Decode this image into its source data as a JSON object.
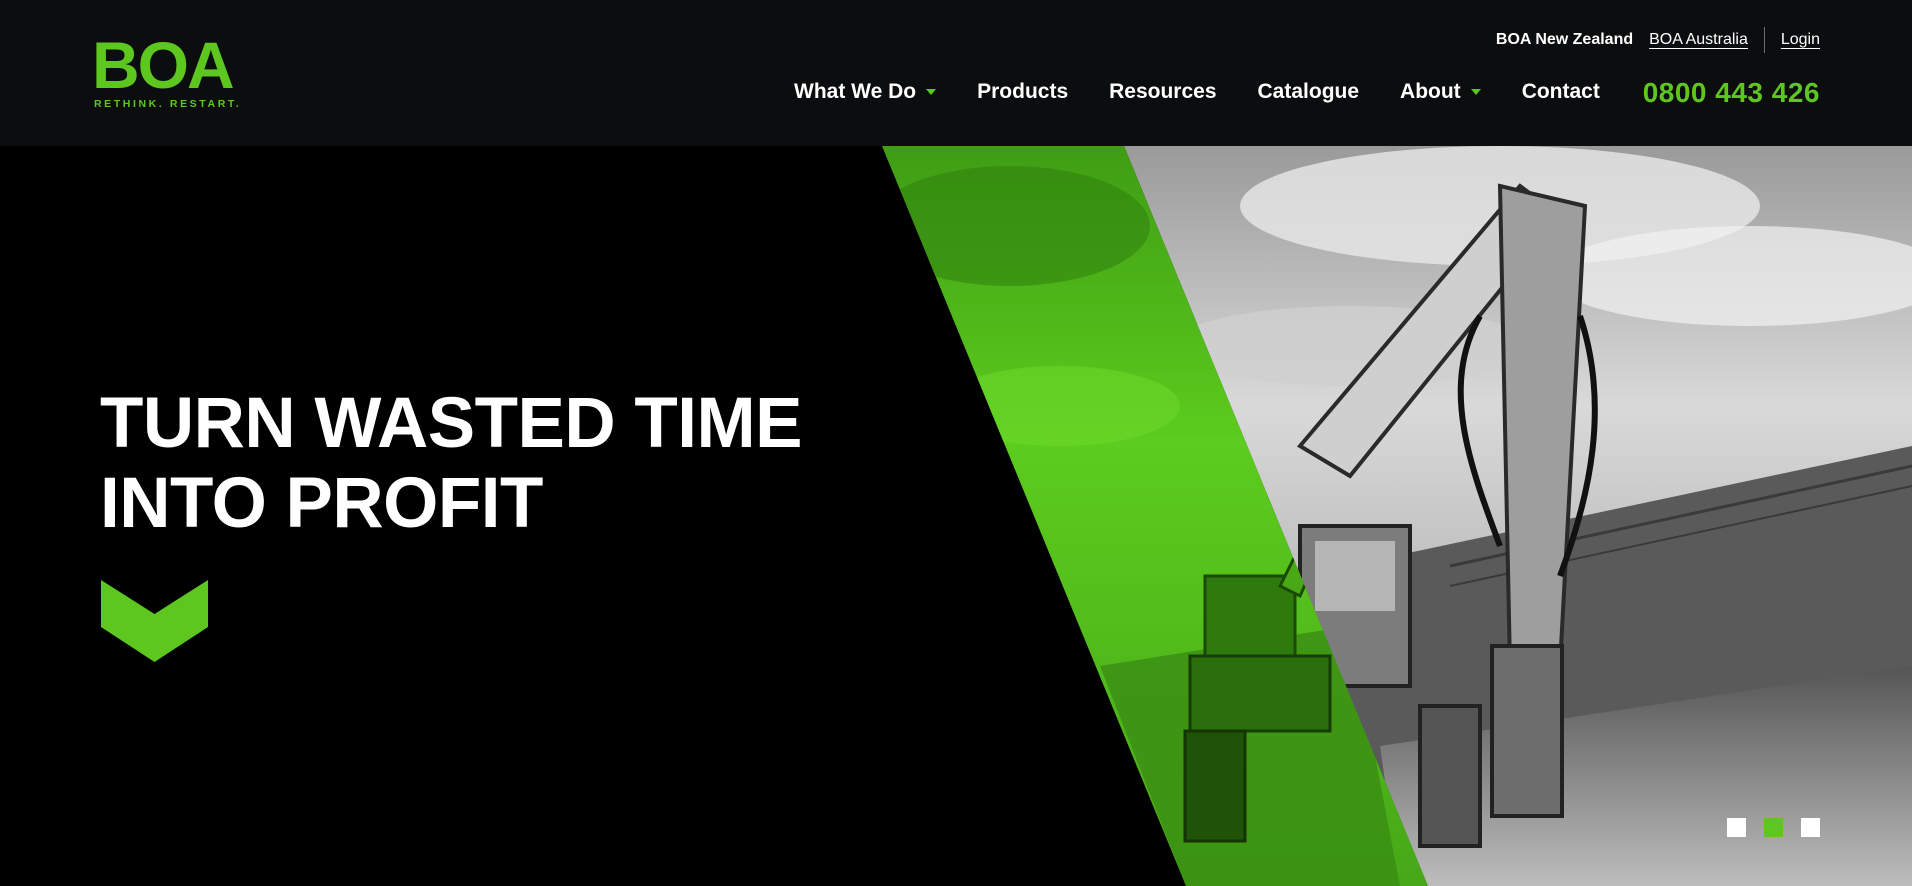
{
  "brand": {
    "logo_text": "BOA",
    "tagline": "RETHINK. RESTART.",
    "accent_color": "#5dc61f",
    "header_bg": "#0c0d0f"
  },
  "topbar": {
    "current_region": "BOA New Zealand",
    "other_region": "BOA Australia",
    "login": "Login"
  },
  "nav": {
    "items": [
      {
        "label": "What We Do",
        "has_dropdown": true
      },
      {
        "label": "Products",
        "has_dropdown": false
      },
      {
        "label": "Resources",
        "has_dropdown": false
      },
      {
        "label": "Catalogue",
        "has_dropdown": false
      },
      {
        "label": "About",
        "has_dropdown": true
      },
      {
        "label": "Contact",
        "has_dropdown": false
      }
    ],
    "phone": "0800 443 426"
  },
  "hero": {
    "headline_line1": "TURN WASTED TIME",
    "headline_line2": "INTO PROFIT",
    "scroll_icon": "chevron-down-icon",
    "image": "excavator-photo",
    "slides": {
      "count": 3,
      "active_index": 1
    }
  }
}
